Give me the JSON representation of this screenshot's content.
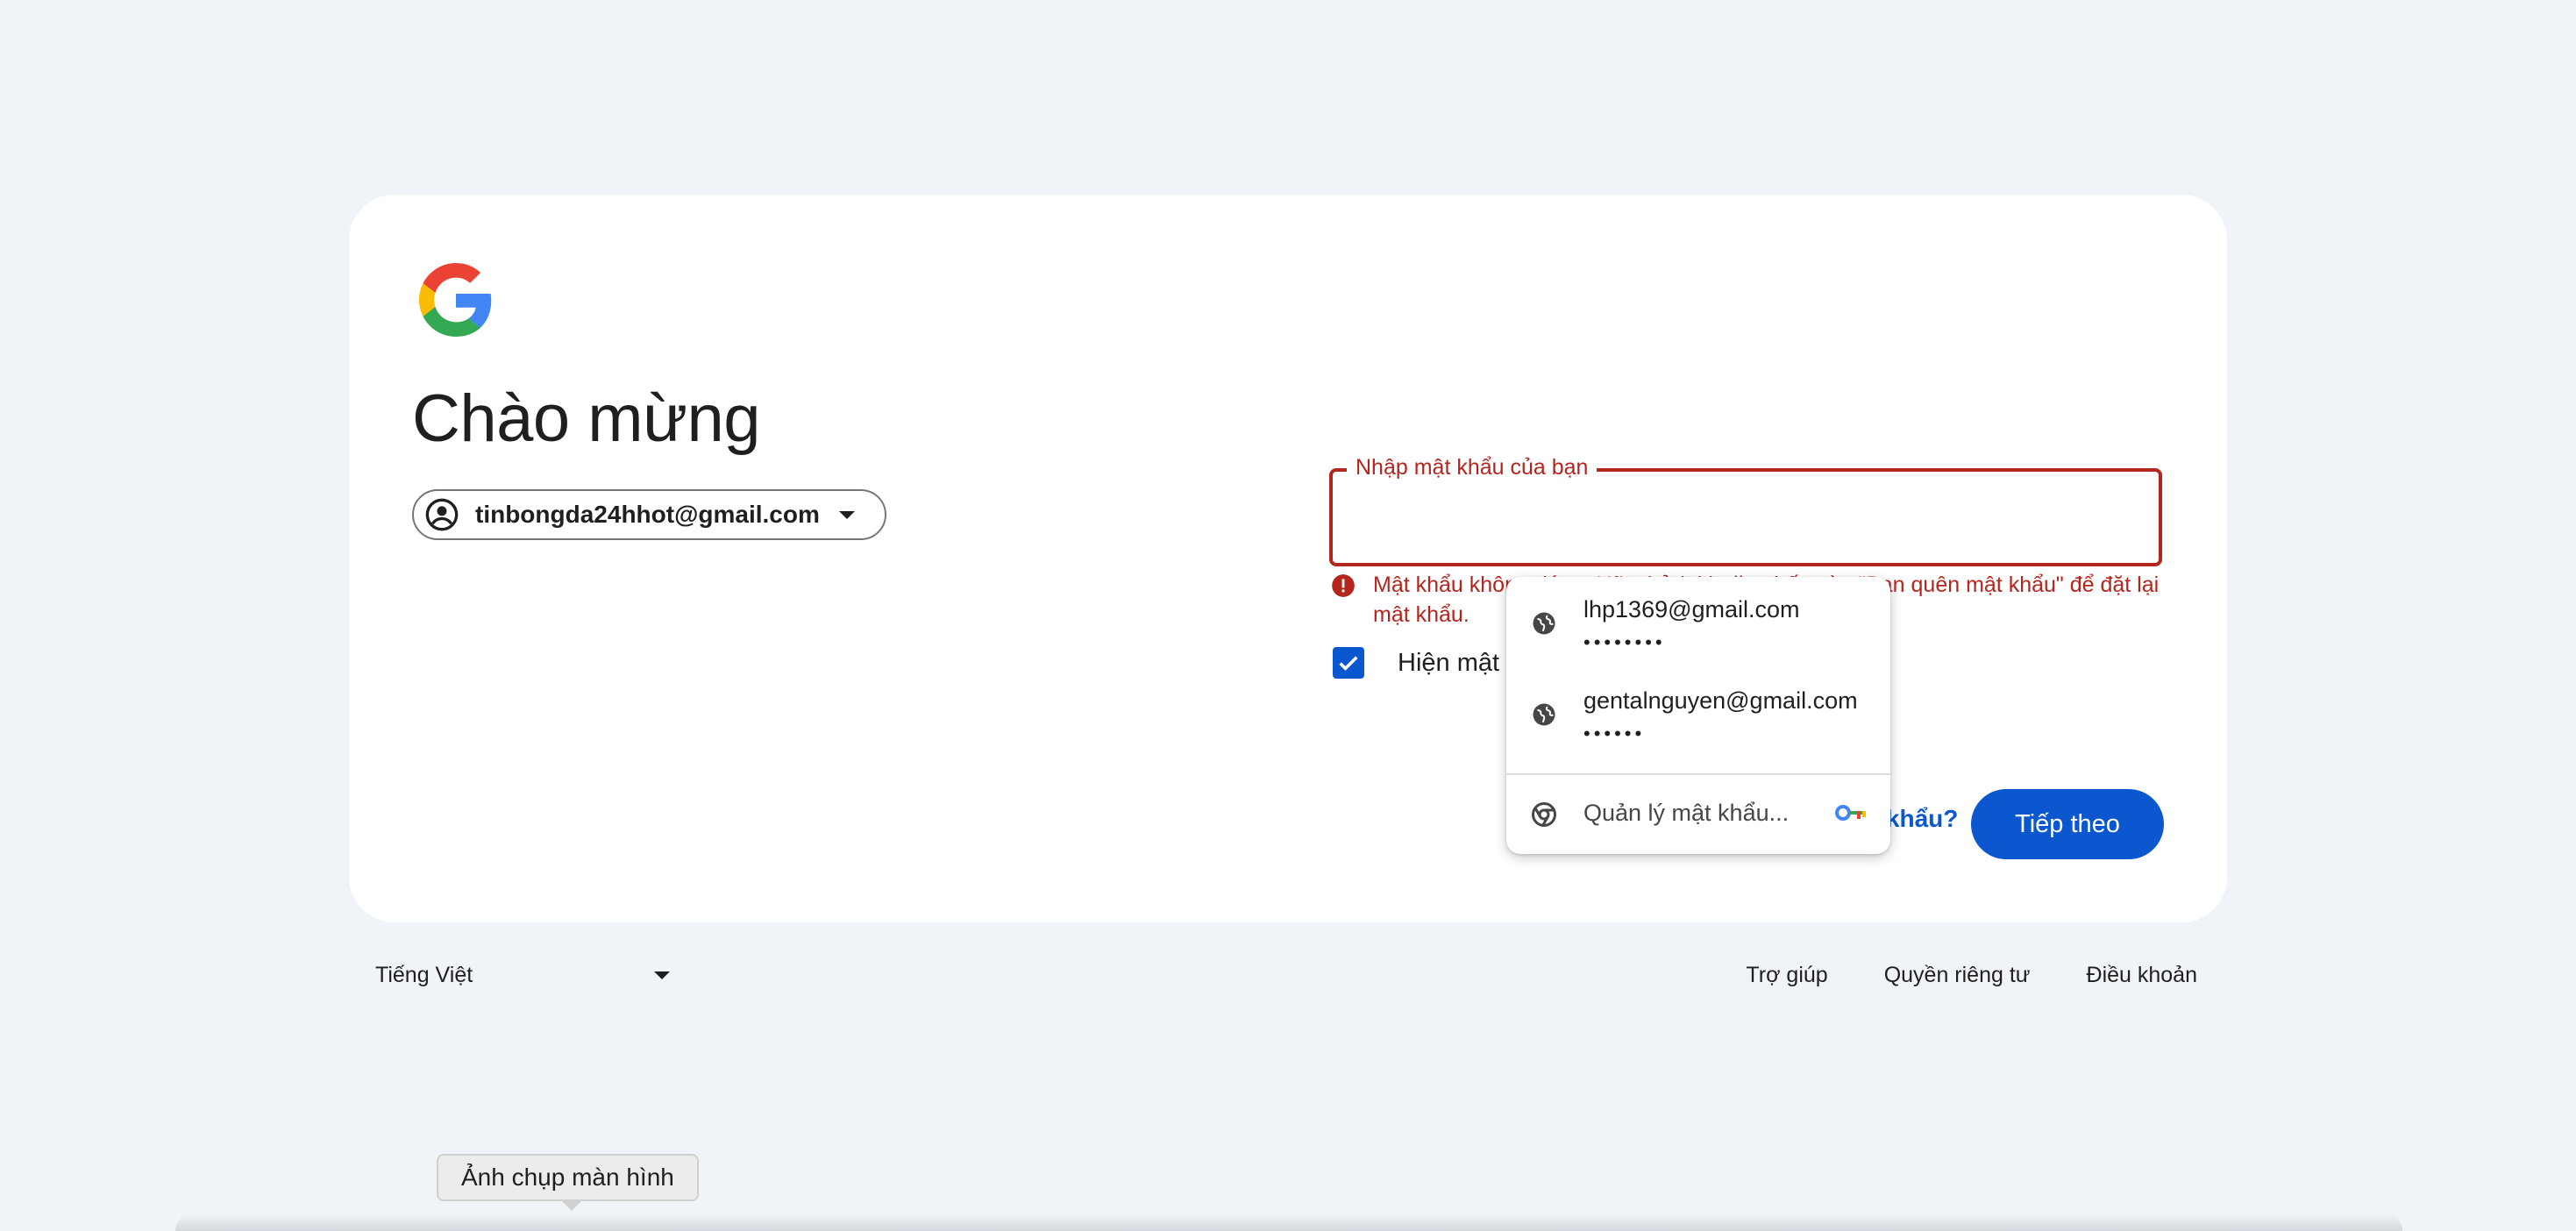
{
  "signin": {
    "headline": "Chào mừng",
    "account_email": "tinbongda24hhot@gmail.com",
    "password_label": "Nhập mật khẩu của bạn",
    "password_value": "",
    "error_message": "Mật khẩu không đúng. Hãy thử lại hoặc nhấp vào \"Bạn quên mật khẩu\" để đặt lại mật khẩu.",
    "show_password_label": "Hiện mật khẩu",
    "show_password_checked": true,
    "forgot_password_link": "Bạn quên mật khẩu?",
    "next_button": "Tiếp theo"
  },
  "autofill": {
    "suggestions": [
      {
        "username": "lhp1369@gmail.com",
        "password_mask": "••••••••"
      },
      {
        "username": "gentalnguyen@gmail.com",
        "password_mask": "••••••"
      }
    ],
    "manage_label": "Quản lý mật khẩu..."
  },
  "footer": {
    "language": "Tiếng Việt",
    "links": [
      "Trợ giúp",
      "Quyền riêng tư",
      "Điều khoản"
    ]
  },
  "tooltip": {
    "text": "Ảnh chụp màn hình"
  },
  "colors": {
    "background": "#f0f4f9",
    "primary": "#0b57d0",
    "error": "#b3261e"
  }
}
